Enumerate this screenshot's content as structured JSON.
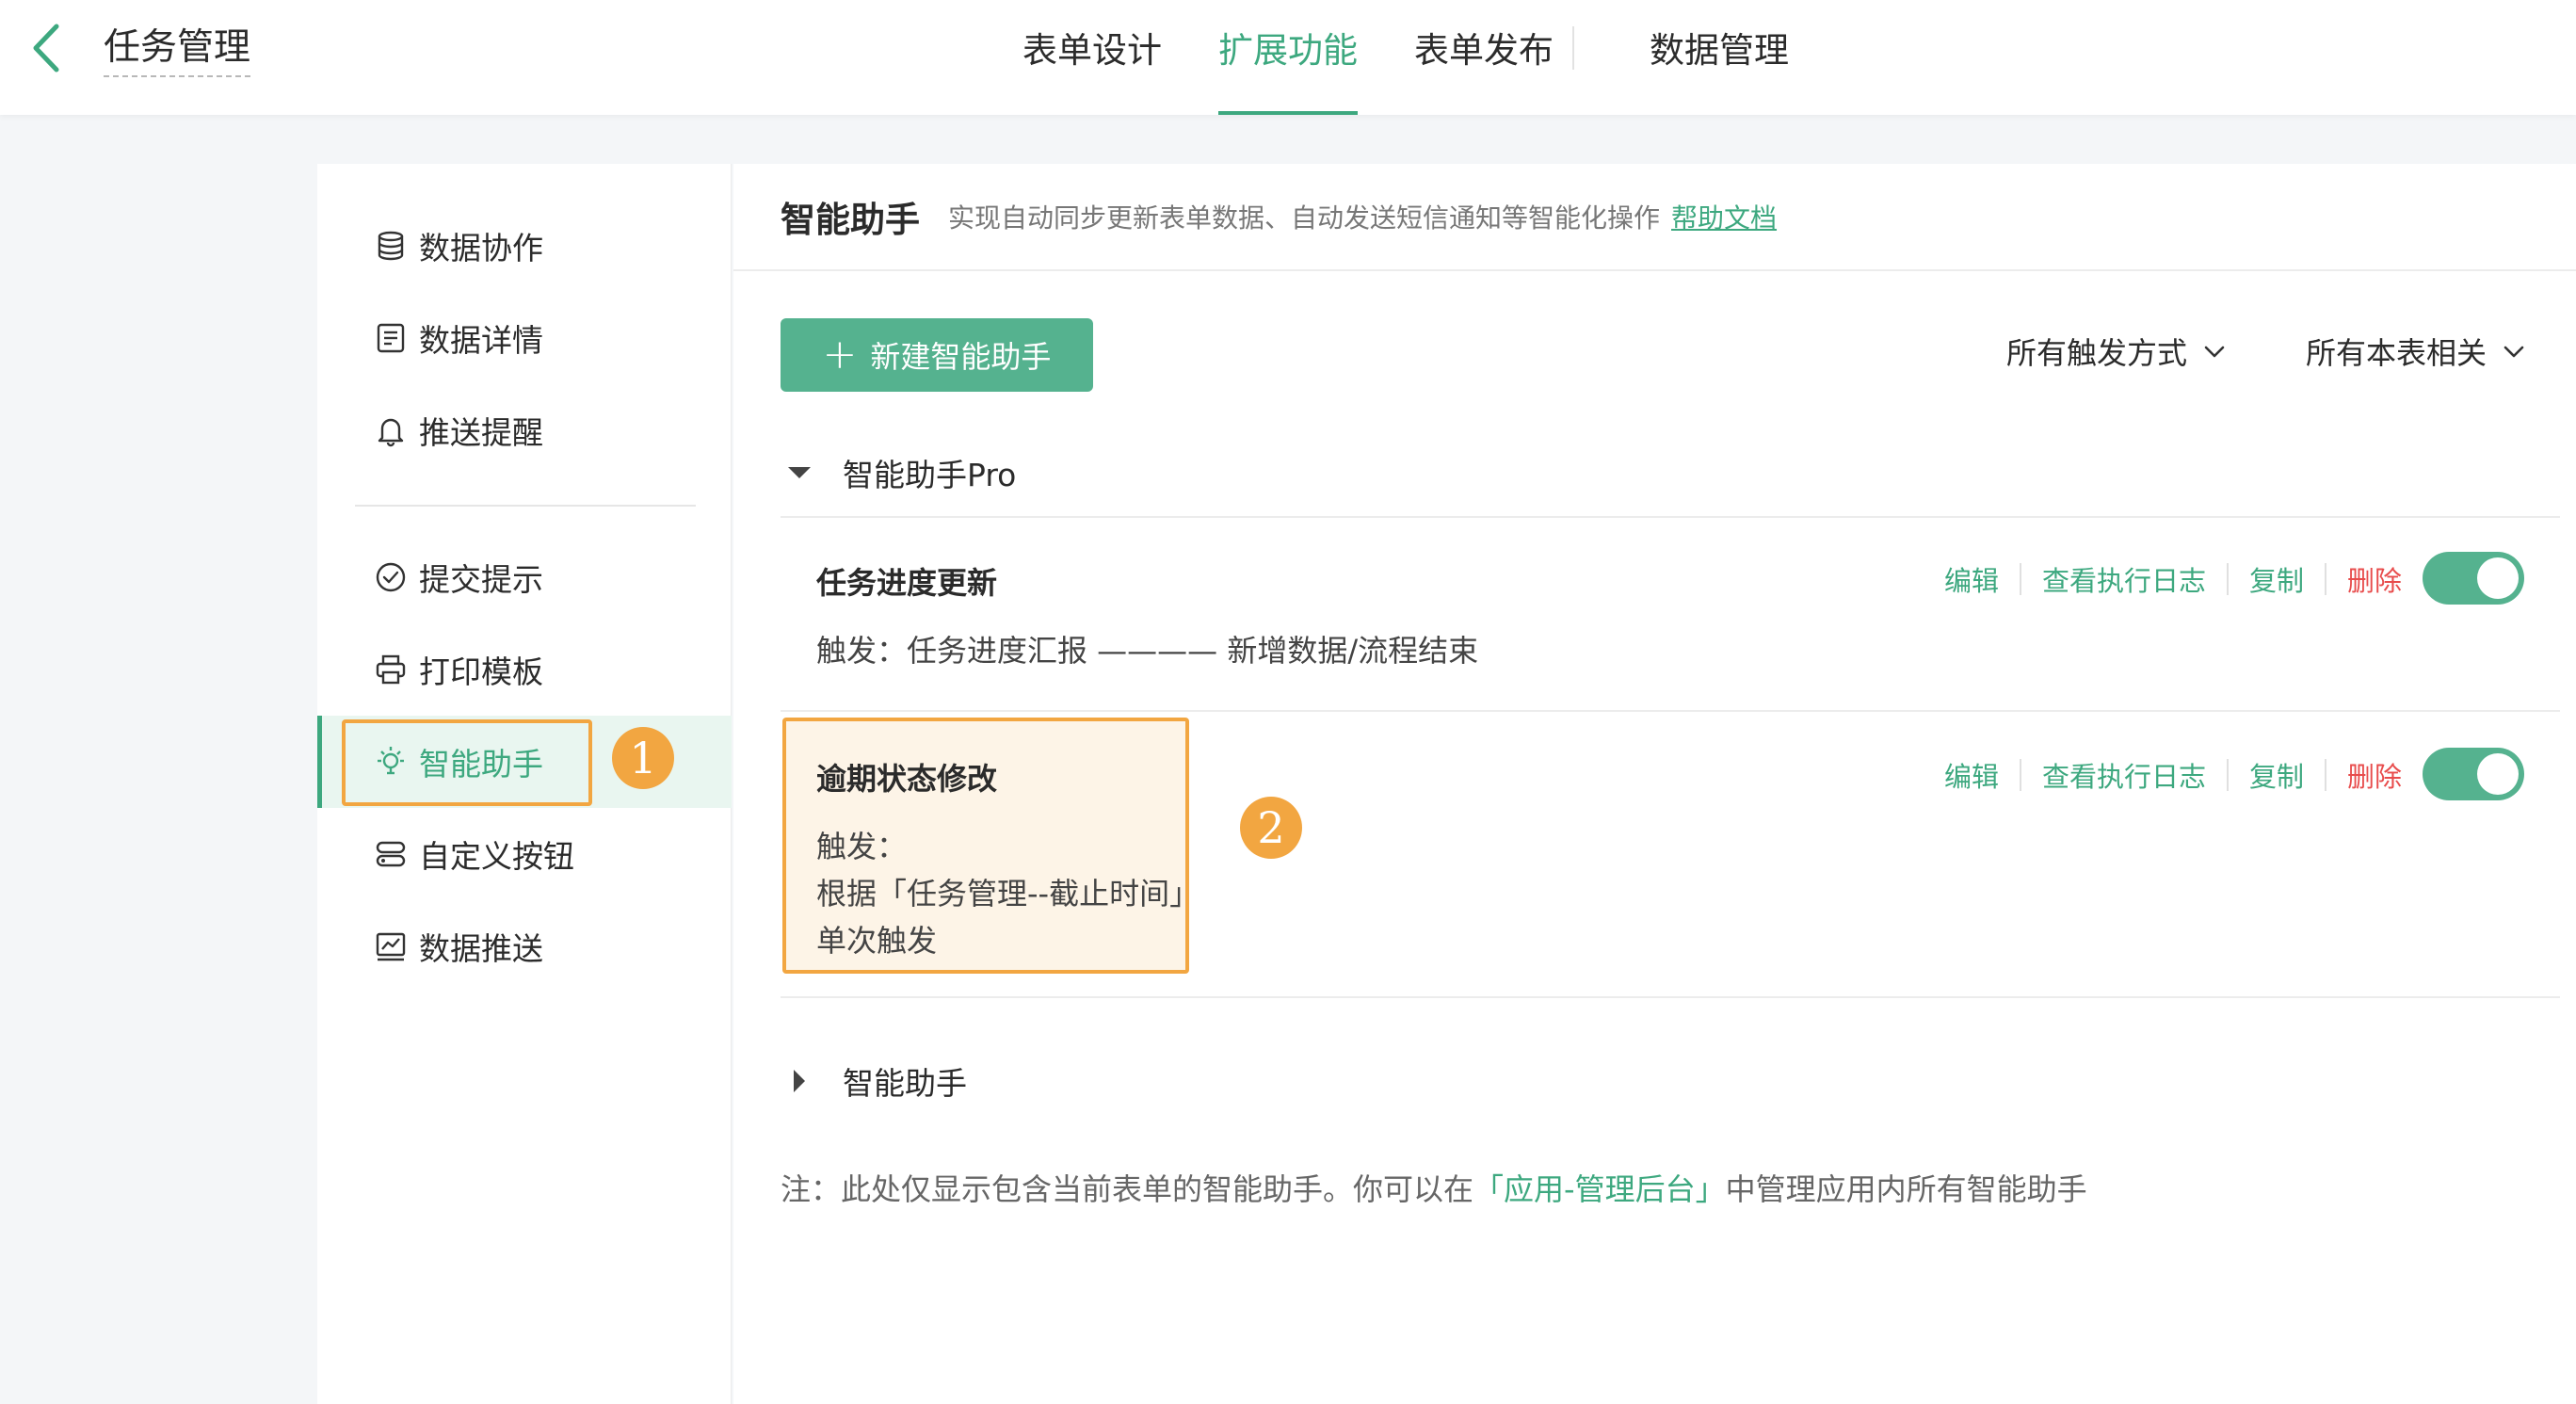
{
  "header": {
    "title": "任务管理",
    "tabs": [
      {
        "label": "表单设计",
        "active": false
      },
      {
        "label": "扩展功能",
        "active": true
      },
      {
        "label": "表单发布",
        "active": false
      },
      {
        "label": "数据管理",
        "active": false
      }
    ]
  },
  "sidebar": {
    "items": [
      {
        "label": "数据协作",
        "icon": "database-icon"
      },
      {
        "label": "数据详情",
        "icon": "document-icon"
      },
      {
        "label": "推送提醒",
        "icon": "bell-icon"
      },
      {
        "label": "提交提示",
        "icon": "check-circle-icon"
      },
      {
        "label": "打印模板",
        "icon": "printer-icon"
      },
      {
        "label": "智能助手",
        "icon": "lightbulb-icon",
        "active": true
      },
      {
        "label": "自定义按钮",
        "icon": "buttons-icon"
      },
      {
        "label": "数据推送",
        "icon": "chart-icon"
      }
    ]
  },
  "badges": {
    "one": "1",
    "two": "2"
  },
  "main": {
    "title": "智能助手",
    "description": "实现自动同步更新表单数据、自动发送短信通知等智能化操作",
    "help_link": "帮助文档",
    "new_button": "新建智能助手",
    "filter_trigger": "所有触发方式",
    "filter_scope": "所有本表相关",
    "groups": [
      {
        "label": "智能助手Pro",
        "expanded": true
      },
      {
        "label": "智能助手",
        "expanded": false
      }
    ],
    "cards": [
      {
        "title": "任务进度更新",
        "trigger_text": "触发：任务进度汇报 ———— 新增数据/流程结束",
        "enabled": true
      },
      {
        "title": "逾期状态修改",
        "trigger_line1": "触发：",
        "trigger_line2": "根据「任务管理--截止时间」",
        "trigger_line3": "单次触发",
        "enabled": true
      }
    ],
    "actions": {
      "edit": "编辑",
      "log": "查看执行日志",
      "copy": "复制",
      "delete": "删除"
    },
    "note": {
      "prefix": "注：此处仅显示包含当前表单的智能助手。你可以在",
      "link": "「应用-管理后台」",
      "suffix": "中管理应用内所有智能助手"
    }
  },
  "colors": {
    "accent": "#3da87f",
    "highlight": "#f2a641",
    "danger": "#e84c4c"
  }
}
